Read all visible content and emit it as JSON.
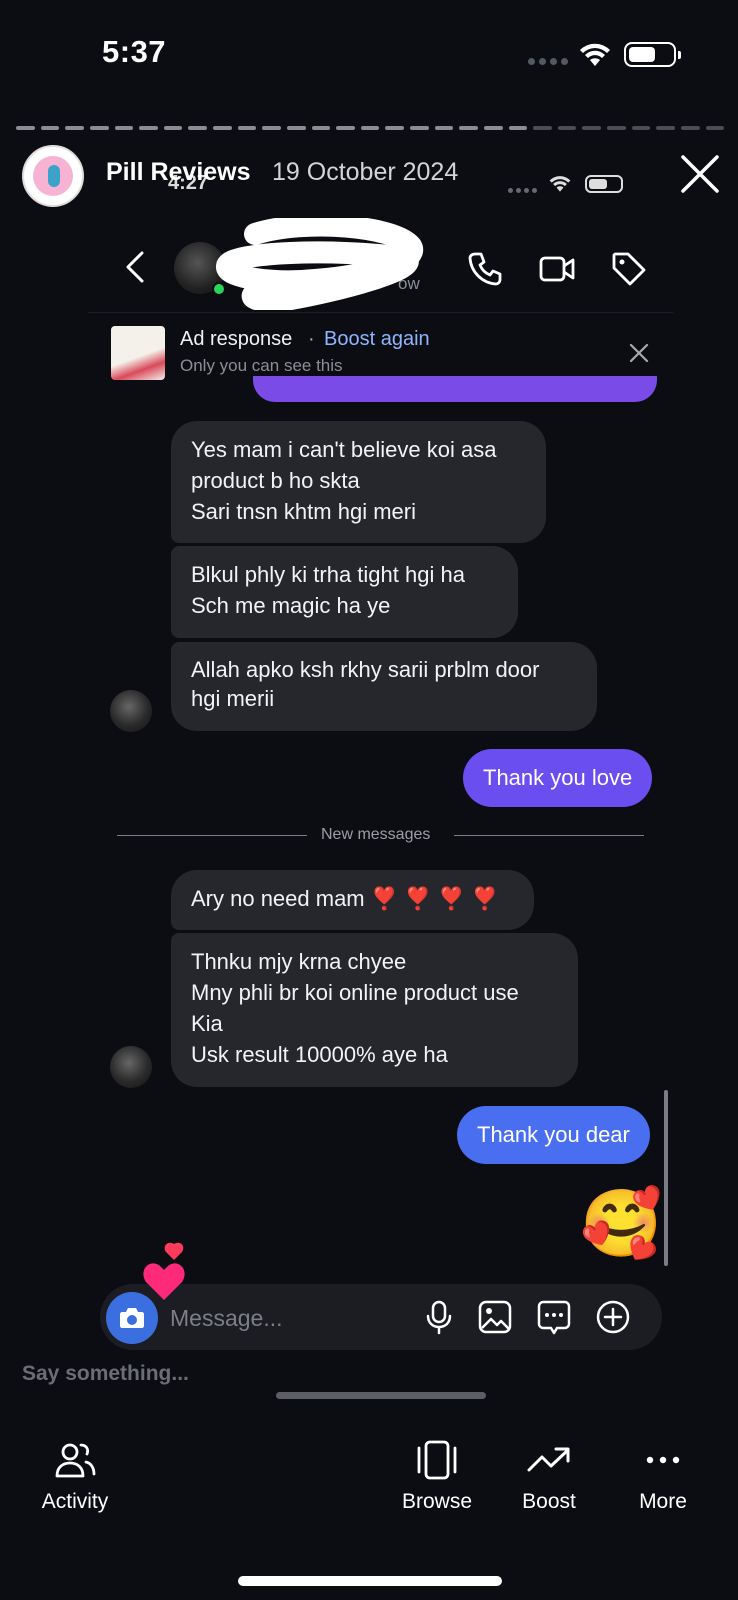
{
  "status_bar": {
    "time": "5:37"
  },
  "story": {
    "username": "Pill Reviews",
    "date": "19 October 2024",
    "close_label": "close-story"
  },
  "inner_status": {
    "time": "4:27"
  },
  "chat_header": {
    "name": "",
    "subtitle": "ow"
  },
  "ad_response": {
    "title": "Ad response",
    "separator": "·",
    "boost_link": "Boost again",
    "subtitle": "Only you can see this"
  },
  "messages": {
    "m1": {
      "lines": [
        "Yes mam i can't believe koi asa",
        "product b ho skta",
        "Sari tnsn khtm hgi meri"
      ]
    },
    "m2": {
      "lines": [
        "Blkul phly ki trha tight hgi ha",
        "Sch me magic ha ye"
      ]
    },
    "m3": {
      "lines": [
        "Allah apko ksh rkhy sarii prblm door",
        "hgi merii"
      ]
    },
    "m4": {
      "text": "Thank you love",
      "color": "#6a4ef0"
    },
    "divider": "New messages",
    "m5": {
      "lines": [
        "Ary no need mam ❣️ ❣️ ❣️ ❣️"
      ]
    },
    "m6": {
      "lines": [
        "Thnku mjy krna chyee",
        "Mny phli br koi online product use",
        "Kia",
        "Usk result 10000% aye ha"
      ]
    },
    "m7": {
      "text": "Thank you dear",
      "color": "#4a6ef0"
    },
    "m8": {
      "emoji": "🥰"
    }
  },
  "composer": {
    "placeholder": "Message..."
  },
  "story_reply": {
    "placeholder": "Say something..."
  },
  "tabs": [
    {
      "label": "Activity",
      "icon": "people-icon"
    },
    {
      "label": "Browse",
      "icon": "browse-icon"
    },
    {
      "label": "Boost",
      "icon": "trend-icon"
    },
    {
      "label": "More",
      "icon": "more-icon"
    }
  ]
}
